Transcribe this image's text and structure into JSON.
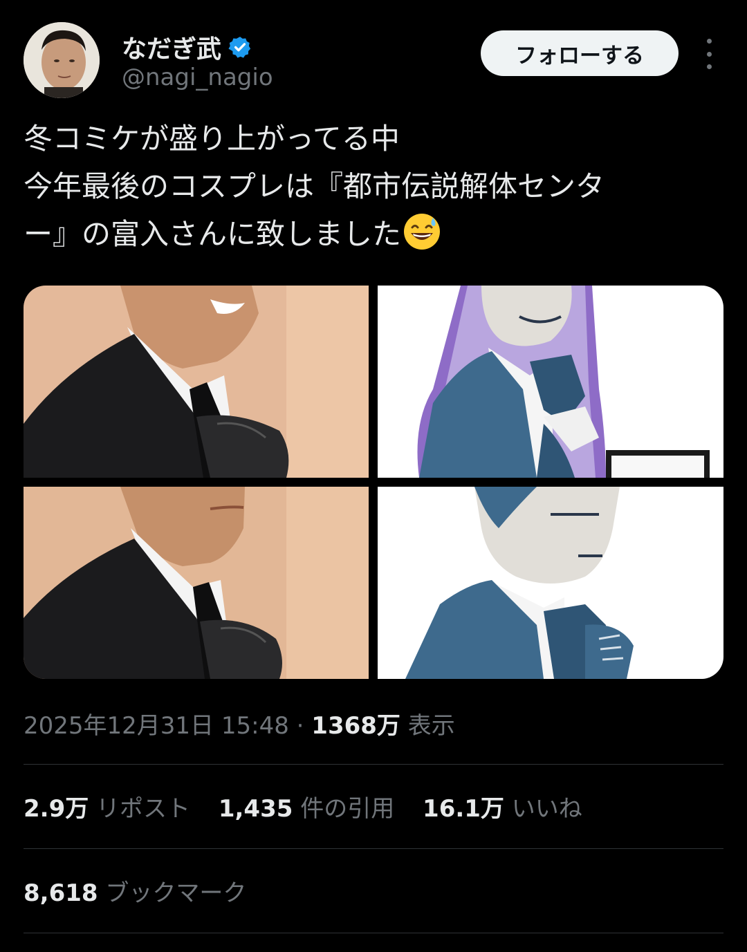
{
  "author": {
    "display_name": "なだぎ武",
    "handle": "@nagi_nagio",
    "verified": true
  },
  "follow_button": {
    "label": "フォローする"
  },
  "tweet": {
    "lines": [
      "冬コミケが盛り上がってる中",
      "今年最後のコスプレは『都市伝説解体センタ",
      "ー』の富入さんに致しました"
    ],
    "emoji": "grinning-face-with-sweat"
  },
  "media": [
    {
      "name": "cosplay-photo-smiling"
    },
    {
      "name": "pixel-art-character-smiling"
    },
    {
      "name": "cosplay-photo-serious"
    },
    {
      "name": "pixel-art-character-serious"
    }
  ],
  "meta": {
    "timestamp": "2025年12月31日 15:48",
    "separator": "·",
    "views_count": "1368万",
    "views_label": "表示"
  },
  "stats": {
    "reposts_count": "2.9万",
    "reposts_label": "リポスト",
    "quotes_count": "1,435",
    "quotes_label": "件の引用",
    "likes_count": "16.1万",
    "likes_label": "いいね",
    "bookmarks_count": "8,618",
    "bookmarks_label": "ブックマーク"
  },
  "colors": {
    "background": "#000000",
    "text_primary": "#e7e9ea",
    "text_secondary": "#71767b",
    "verified_blue": "#1d9bf0",
    "divider": "#2f3336"
  }
}
